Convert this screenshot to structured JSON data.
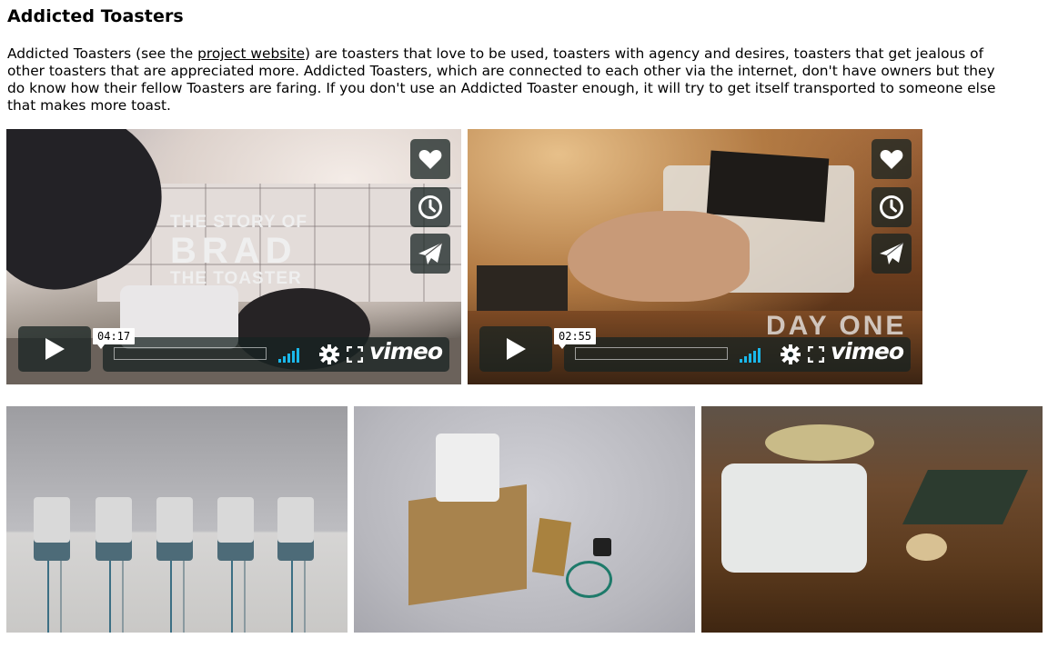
{
  "page": {
    "title": "Addicted Toasters",
    "intro": {
      "text_before_link": "Addicted Toasters (see the ",
      "link_text": "project website",
      "lines": [
        ") are toasters that love to be used, toasters with agency and desires, toasters that get jealous of",
        "other toasters that are appreciated more. Addicted Toasters, which are connected to each other via the internet, don't have owners but they",
        "do know how their fellow Toasters are faring. If you don't use an Addicted Toaster enough, it will try to get itself transported to someone else",
        "that makes more toast."
      ]
    }
  },
  "videos": [
    {
      "overlay_line1": "THE STORY OF",
      "overlay_line2": "BRAD",
      "overlay_line3": "THE TOASTER",
      "duration": "04:17",
      "brand": "vimeo",
      "progress": 0
    },
    {
      "overlay_line1": "DAY ONE",
      "duration": "02:55",
      "brand": "vimeo",
      "progress": 0
    }
  ],
  "colors": {
    "player_bg": "#172322",
    "player_accent": "#1ab7ea",
    "link": "#000000"
  },
  "icons": {
    "like": "heart-icon",
    "watch_later": "clock-icon",
    "share": "paper-plane-icon",
    "play": "play-icon",
    "volume": "volume-bars-icon",
    "settings": "gear-icon",
    "fullscreen": "fullscreen-icon"
  }
}
